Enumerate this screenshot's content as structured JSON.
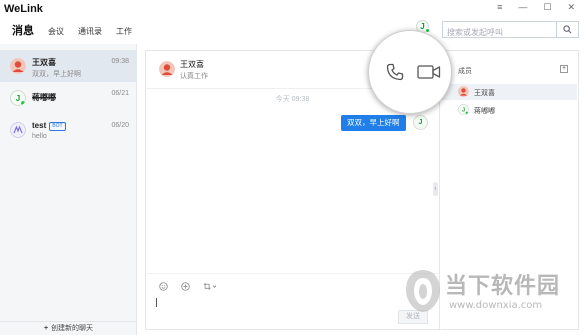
{
  "app": {
    "title": "WeLink"
  },
  "nav": {
    "items": [
      "消息",
      "会议",
      "通讯录",
      "工作"
    ]
  },
  "window_controls": {
    "menu": "≡",
    "minimize": "—",
    "maximize": "☐",
    "close": "✕"
  },
  "header": {
    "avatar_initial": "J",
    "search_placeholder": "搜索或发起呼叫"
  },
  "sidebar": {
    "conversations": [
      {
        "name": "王双喜",
        "preview": "双双，早上好啊",
        "time": "09:38",
        "avatar_color": "#e24b3b",
        "active": true
      },
      {
        "name": "蒋嘟嘟",
        "preview": "",
        "time": "06/21",
        "avatar_color": "#1a9a3a",
        "active": false
      },
      {
        "name": "test",
        "badge": "BOT",
        "preview": "hello",
        "time": "06/20",
        "avatar_color": "#7a6ad8",
        "active": false
      }
    ],
    "new_chat_label": "创建新的聊天"
  },
  "chat": {
    "title": "王双喜",
    "subtitle": "认真工作",
    "time_label": "今天 09:38",
    "message": "双双，早上好啊",
    "my_avatar_initial": "J",
    "send_label": "发送"
  },
  "members": {
    "title": "成员",
    "list": [
      {
        "name": "王双喜",
        "avatar_color": "#e24b3b"
      },
      {
        "name": "蒋嘟嘟",
        "avatar_color": "#1a9a3a"
      }
    ]
  },
  "watermark": {
    "title": "当下软件园",
    "url": "www.downxia.com"
  },
  "colors": {
    "accent": "#1f7ee8",
    "online": "#20c040",
    "bubble_text": "#ffffff"
  }
}
